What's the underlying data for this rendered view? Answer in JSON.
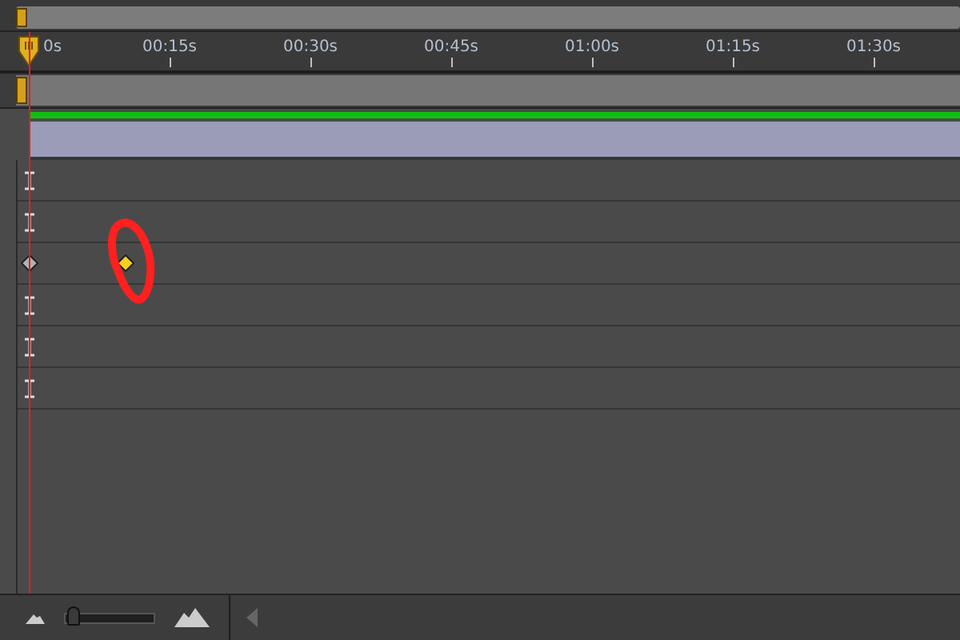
{
  "ruler": {
    "labels": [
      "0s",
      "00:15s",
      "00:30s",
      "00:45s",
      "01:00s",
      "01:15s",
      "01:30s"
    ]
  },
  "tracks": [
    {
      "kind": "hold"
    },
    {
      "kind": "hold"
    },
    {
      "kind": "keyframes",
      "keys": [
        {
          "selected": false
        },
        {
          "selected": true
        }
      ]
    },
    {
      "kind": "hold"
    },
    {
      "kind": "hold"
    },
    {
      "kind": "hold"
    }
  ],
  "zoom_slider": {
    "level": 0.05
  }
}
